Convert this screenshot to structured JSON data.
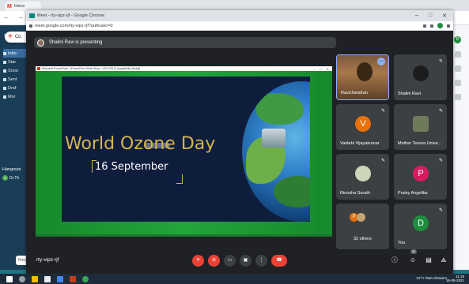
{
  "background_window": {
    "tab_label": "Inbox",
    "compose_label": "Co",
    "left_items": [
      "Inbo",
      "Star",
      "Snoo",
      "Sent",
      "Draf",
      "Mor"
    ],
    "hangouts_label": "Hangouts",
    "hangouts_user": "Dr.Th",
    "message_placeholder": "Messa",
    "profile_initial": "D"
  },
  "window": {
    "title": "Meet - rty-vipz-rjf - Google Chrome",
    "url": "meet.google.com/rty-vipz-rjf?authuser=0",
    "controls": [
      "–",
      "□",
      "✕"
    ]
  },
  "presenting": {
    "text": "Shalini Ravi is presenting"
  },
  "shared_screen": {
    "window_title": "Microsoft PowerPoint - [PowerPoint Slide Show - UPU Pdf [Compatibility Mode]]",
    "slide_title": "World Ozone Day",
    "slide_subtitle": "16 September"
  },
  "participants": [
    {
      "name": "Ravichandran",
      "type": "video"
    },
    {
      "name": "Shalini Ravi",
      "type": "image"
    },
    {
      "name": "Vaidehi Vijayakumar",
      "initial": "V",
      "color": "#e8710a"
    },
    {
      "name": "Mother Teresa Unive...",
      "type": "image"
    },
    {
      "name": "Rinosha Surath",
      "type": "image"
    },
    {
      "name": "Praisy Angelika",
      "initial": "P",
      "color": "#d81b60"
    },
    {
      "name": "32 others",
      "initial": "P"
    },
    {
      "name": "You",
      "initial": "D",
      "color": "#1e8e3e"
    }
  ],
  "bottom": {
    "meeting_code": "rty-vipz-rjf",
    "participant_count": "40"
  },
  "taskbar": {
    "weather": "31°C  Rain showers",
    "lang": "ENG",
    "time": "11:19",
    "date": "16-09-2021"
  }
}
